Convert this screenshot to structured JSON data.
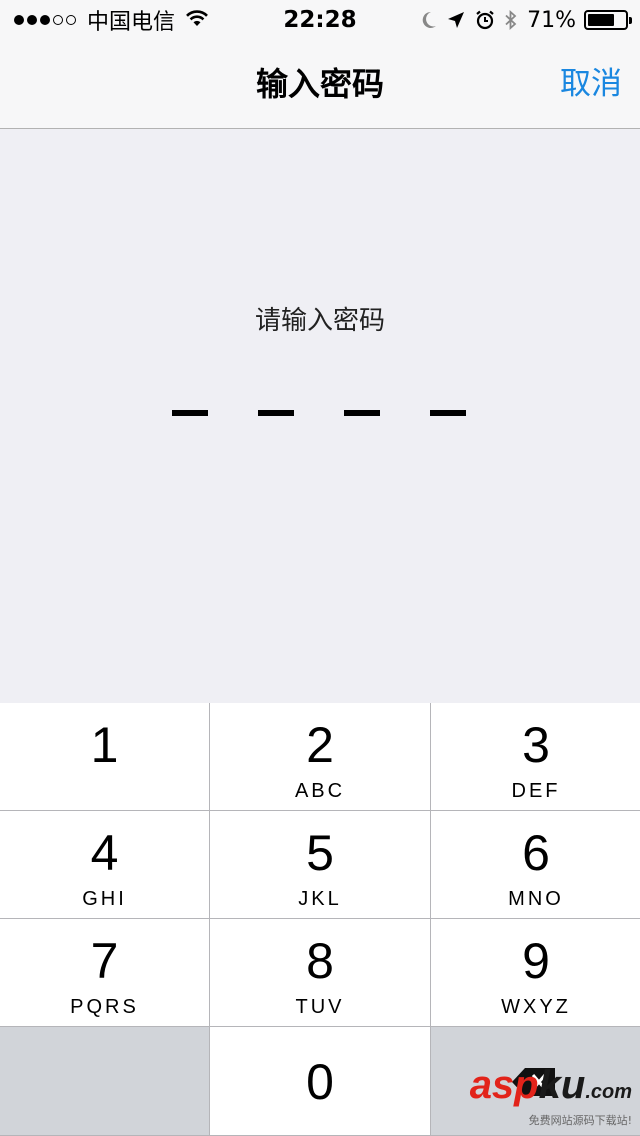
{
  "status_bar": {
    "signal_filled": 3,
    "signal_empty": 2,
    "carrier": "中国电信",
    "time": "22:28",
    "battery_percent": "71%",
    "battery_level": 0.71,
    "icons": [
      "wifi-icon",
      "moon-icon",
      "location-arrow-icon",
      "alarm-icon",
      "bluetooth-icon",
      "battery-icon"
    ]
  },
  "nav": {
    "title": "输入密码",
    "cancel_label": "取消",
    "accent_color": "#1a87e0"
  },
  "prompt": {
    "text": "请输入密码",
    "slots": 4,
    "filled": 0
  },
  "keypad": {
    "keys": [
      {
        "digit": "1",
        "letters": ""
      },
      {
        "digit": "2",
        "letters": "ABC"
      },
      {
        "digit": "3",
        "letters": "DEF"
      },
      {
        "digit": "4",
        "letters": "GHI"
      },
      {
        "digit": "5",
        "letters": "JKL"
      },
      {
        "digit": "6",
        "letters": "MNO"
      },
      {
        "digit": "7",
        "letters": "PQRS"
      },
      {
        "digit": "8",
        "letters": "TUV"
      },
      {
        "digit": "9",
        "letters": "WXYZ"
      },
      {
        "digit": "",
        "letters": ""
      },
      {
        "digit": "0",
        "letters": ""
      },
      {
        "digit": "",
        "letters": "",
        "icon": "backspace-icon"
      }
    ]
  },
  "watermark": {
    "brand_red": "asp",
    "brand_dark": "ku",
    "brand_suffix": ".com",
    "tagline": "免费网站源码下载站!"
  }
}
